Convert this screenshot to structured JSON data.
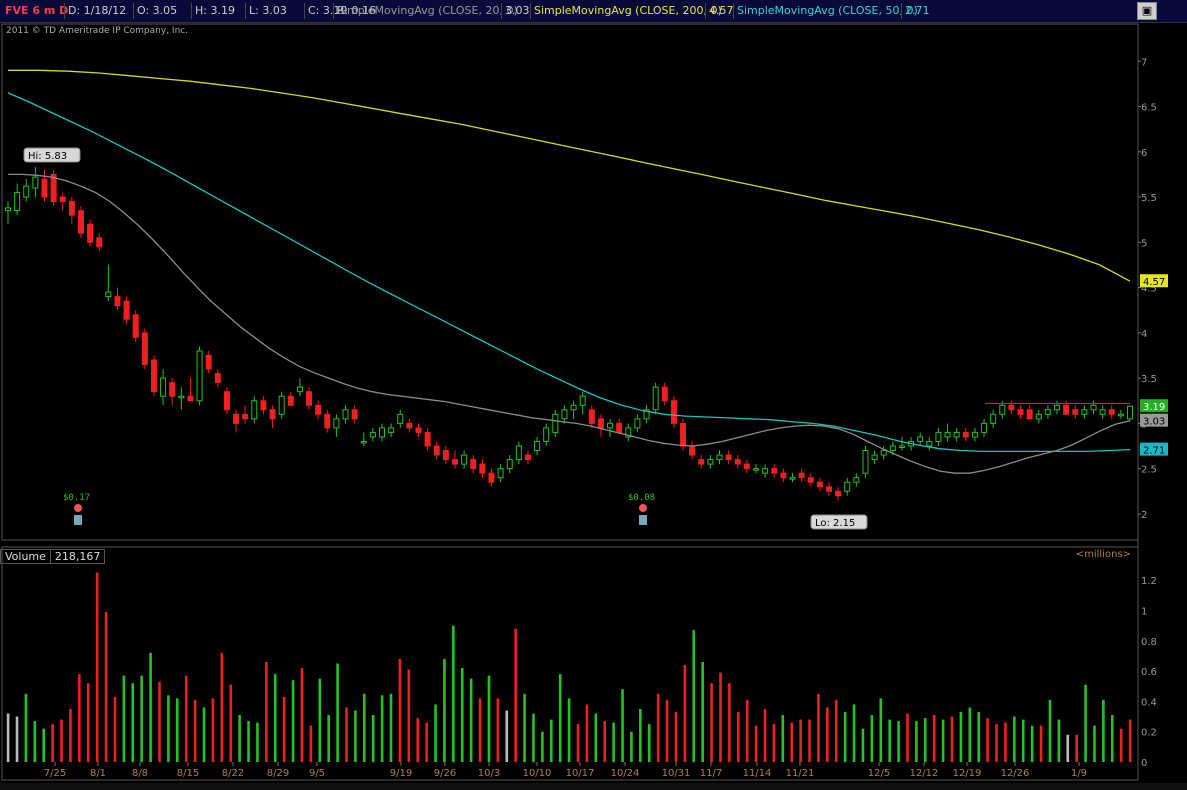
{
  "header": {
    "symbol": "FVE 6 m D",
    "date": "D: 1/18/12",
    "open": "O: 3.05",
    "high": "H: 3.19",
    "low": "L: 3.03",
    "close": "C: 3.19",
    "range": "R: 0.16",
    "sma20_label": "SimpleMovingAvg (CLOSE, 20, 0)",
    "sma20_value": "3.03",
    "sma200_label": "SimpleMovingAvg (CLOSE, 200, 0)",
    "sma200_value": "4.57",
    "sma50_label": "SimpleMovingAvg (CLOSE, 50, 0)",
    "sma50_value": "2.71"
  },
  "copyright": "2011 © TD Ameritrade IP Company, Inc.",
  "volume_panel": {
    "label": "Volume",
    "value": "218,167",
    "units": "<millions>"
  },
  "colors": {
    "up": "#22c322",
    "down": "#ee2020",
    "sma20": "#8c8c8c",
    "sma50": "#19c3c3",
    "sma200": "#d8d820",
    "bg": "#000000"
  },
  "chart_data": [
    {
      "type": "candlestick",
      "title": "FVE 6 m D",
      "ylim": [
        1.8,
        7.5
      ],
      "y_ticks": [
        2,
        2.5,
        3,
        3.5,
        4,
        4.5,
        5,
        5.5,
        6,
        6.5,
        7
      ],
      "x_ticks": [
        "7/25",
        "8/1",
        "8/8",
        "8/15",
        "8/22",
        "8/29",
        "9/5",
        "9/19",
        "9/26",
        "10/3",
        "10/10",
        "10/17",
        "10/24",
        "10/31",
        "11/7",
        "11/14",
        "11/21",
        "12/5",
        "12/12",
        "12/19",
        "12/26",
        "1/9"
      ],
      "annotations": {
        "high": "Hi: 5.83",
        "low": "Lo: 2.15",
        "dividends": [
          "$0.17",
          "$0.08"
        ]
      },
      "price_labels": {
        "close": "3.19",
        "sma20": "3.03",
        "sma50": "2.71",
        "sma200": "4.57"
      },
      "candles": [
        [
          5.35,
          5.45,
          5.2,
          5.38
        ],
        [
          5.35,
          5.65,
          5.3,
          5.55
        ],
        [
          5.5,
          5.7,
          5.45,
          5.62
        ],
        [
          5.6,
          5.83,
          5.5,
          5.72
        ],
        [
          5.7,
          5.8,
          5.45,
          5.5
        ],
        [
          5.75,
          5.8,
          5.4,
          5.45
        ],
        [
          5.5,
          5.55,
          5.35,
          5.45
        ],
        [
          5.45,
          5.5,
          5.2,
          5.3
        ],
        [
          5.35,
          5.4,
          5.05,
          5.1
        ],
        [
          5.2,
          5.25,
          4.95,
          5.0
        ],
        [
          5.05,
          5.1,
          4.9,
          4.95
        ],
        [
          4.4,
          4.75,
          4.35,
          4.45
        ],
        [
          4.4,
          4.5,
          4.25,
          4.3
        ],
        [
          4.35,
          4.4,
          4.1,
          4.15
        ],
        [
          4.2,
          4.25,
          3.9,
          3.95
        ],
        [
          4.0,
          4.05,
          3.6,
          3.65
        ],
        [
          3.7,
          3.75,
          3.3,
          3.35
        ],
        [
          3.3,
          3.6,
          3.2,
          3.5
        ],
        [
          3.45,
          3.5,
          3.2,
          3.3
        ],
        [
          3.3,
          3.4,
          3.15,
          3.3
        ],
        [
          3.3,
          3.5,
          3.25,
          3.25
        ],
        [
          3.25,
          3.85,
          3.2,
          3.8
        ],
        [
          3.75,
          3.8,
          3.55,
          3.6
        ],
        [
          3.55,
          3.6,
          3.4,
          3.45
        ],
        [
          3.35,
          3.4,
          3.1,
          3.15
        ],
        [
          3.1,
          3.15,
          2.9,
          3.0
        ],
        [
          3.1,
          3.2,
          3.0,
          3.05
        ],
        [
          3.05,
          3.3,
          3.0,
          3.25
        ],
        [
          3.25,
          3.3,
          3.1,
          3.15
        ],
        [
          3.15,
          3.2,
          2.95,
          3.05
        ],
        [
          3.1,
          3.35,
          3.05,
          3.3
        ],
        [
          3.3,
          3.35,
          3.2,
          3.2
        ],
        [
          3.35,
          3.5,
          3.3,
          3.4
        ],
        [
          3.35,
          3.4,
          3.15,
          3.2
        ],
        [
          3.2,
          3.25,
          3.05,
          3.1
        ],
        [
          3.1,
          3.15,
          2.9,
          2.95
        ],
        [
          2.95,
          3.1,
          2.85,
          3.05
        ],
        [
          3.05,
          3.2,
          3.0,
          3.15
        ],
        [
          3.15,
          3.2,
          3.0,
          3.05
        ],
        [
          2.8,
          2.9,
          2.75,
          2.8
        ],
        [
          2.85,
          2.95,
          2.8,
          2.9
        ],
        [
          2.85,
          3.0,
          2.8,
          2.95
        ],
        [
          2.9,
          3.0,
          2.85,
          2.95
        ],
        [
          3.0,
          3.15,
          2.95,
          3.1
        ],
        [
          3.0,
          3.05,
          2.9,
          2.95
        ],
        [
          2.95,
          3.0,
          2.85,
          2.9
        ],
        [
          2.9,
          2.95,
          2.7,
          2.75
        ],
        [
          2.75,
          2.8,
          2.6,
          2.65
        ],
        [
          2.7,
          2.75,
          2.55,
          2.6
        ],
        [
          2.6,
          2.7,
          2.5,
          2.55
        ],
        [
          2.55,
          2.7,
          2.5,
          2.65
        ],
        [
          2.6,
          2.65,
          2.45,
          2.5
        ],
        [
          2.55,
          2.6,
          2.4,
          2.45
        ],
        [
          2.45,
          2.5,
          2.3,
          2.35
        ],
        [
          2.4,
          2.55,
          2.35,
          2.5
        ],
        [
          2.5,
          2.65,
          2.45,
          2.6
        ],
        [
          2.6,
          2.8,
          2.55,
          2.75
        ],
        [
          2.65,
          2.7,
          2.55,
          2.6
        ],
        [
          2.7,
          2.85,
          2.65,
          2.8
        ],
        [
          2.8,
          3.0,
          2.75,
          2.95
        ],
        [
          2.9,
          3.15,
          2.85,
          3.1
        ],
        [
          3.05,
          3.2,
          3.0,
          3.15
        ],
        [
          3.15,
          3.25,
          3.05,
          3.2
        ],
        [
          3.2,
          3.35,
          3.1,
          3.3
        ],
        [
          3.15,
          3.2,
          2.95,
          3.0
        ],
        [
          3.05,
          3.1,
          2.85,
          2.95
        ],
        [
          2.95,
          3.05,
          2.85,
          3.0
        ],
        [
          3.0,
          3.05,
          2.9,
          2.9
        ],
        [
          2.85,
          3.0,
          2.8,
          2.95
        ],
        [
          2.95,
          3.1,
          2.9,
          3.05
        ],
        [
          3.05,
          3.2,
          3.0,
          3.15
        ],
        [
          3.15,
          3.45,
          3.1,
          3.4
        ],
        [
          3.4,
          3.45,
          3.2,
          3.25
        ],
        [
          3.25,
          3.3,
          2.95,
          3.0
        ],
        [
          3.0,
          3.05,
          2.7,
          2.75
        ],
        [
          2.75,
          2.8,
          2.6,
          2.65
        ],
        [
          2.6,
          2.65,
          2.5,
          2.55
        ],
        [
          2.55,
          2.65,
          2.5,
          2.6
        ],
        [
          2.6,
          2.7,
          2.55,
          2.65
        ],
        [
          2.65,
          2.7,
          2.55,
          2.6
        ],
        [
          2.6,
          2.65,
          2.5,
          2.55
        ],
        [
          2.55,
          2.6,
          2.45,
          2.5
        ],
        [
          2.5,
          2.55,
          2.45,
          2.5
        ],
        [
          2.45,
          2.55,
          2.4,
          2.5
        ],
        [
          2.5,
          2.55,
          2.4,
          2.45
        ],
        [
          2.45,
          2.5,
          2.35,
          2.4
        ],
        [
          2.4,
          2.45,
          2.35,
          2.4
        ],
        [
          2.45,
          2.5,
          2.35,
          2.4
        ],
        [
          2.4,
          2.45,
          2.3,
          2.35
        ],
        [
          2.35,
          2.4,
          2.25,
          2.3
        ],
        [
          2.3,
          2.35,
          2.2,
          2.25
        ],
        [
          2.25,
          2.3,
          2.15,
          2.2
        ],
        [
          2.25,
          2.4,
          2.2,
          2.35
        ],
        [
          2.35,
          2.45,
          2.3,
          2.4
        ],
        [
          2.45,
          2.75,
          2.4,
          2.7
        ],
        [
          2.6,
          2.7,
          2.55,
          2.65
        ],
        [
          2.65,
          2.75,
          2.6,
          2.7
        ],
        [
          2.7,
          2.8,
          2.65,
          2.75
        ],
        [
          2.75,
          2.85,
          2.7,
          2.75
        ],
        [
          2.75,
          2.85,
          2.7,
          2.8
        ],
        [
          2.8,
          2.9,
          2.75,
          2.85
        ],
        [
          2.75,
          2.85,
          2.7,
          2.8
        ],
        [
          2.8,
          2.95,
          2.75,
          2.9
        ],
        [
          2.85,
          3.0,
          2.8,
          2.9
        ],
        [
          2.85,
          2.95,
          2.8,
          2.9
        ],
        [
          2.9,
          2.95,
          2.8,
          2.85
        ],
        [
          2.85,
          2.95,
          2.8,
          2.9
        ],
        [
          2.9,
          3.05,
          2.85,
          3.0
        ],
        [
          3.0,
          3.15,
          2.95,
          3.1
        ],
        [
          3.1,
          3.25,
          3.05,
          3.2
        ],
        [
          3.2,
          3.25,
          3.1,
          3.15
        ],
        [
          3.15,
          3.2,
          3.05,
          3.1
        ],
        [
          3.15,
          3.2,
          3.05,
          3.05
        ],
        [
          3.05,
          3.15,
          3.0,
          3.1
        ],
        [
          3.1,
          3.2,
          3.05,
          3.15
        ],
        [
          3.15,
          3.25,
          3.1,
          3.2
        ],
        [
          3.2,
          3.25,
          3.1,
          3.1
        ],
        [
          3.15,
          3.2,
          3.05,
          3.1
        ],
        [
          3.1,
          3.2,
          3.05,
          3.15
        ],
        [
          3.15,
          3.25,
          3.1,
          3.2
        ],
        [
          3.1,
          3.2,
          3.05,
          3.15
        ],
        [
          3.15,
          3.2,
          3.05,
          3.1
        ],
        [
          3.1,
          3.15,
          3.05,
          3.1
        ],
        [
          3.05,
          3.19,
          3.03,
          3.19
        ]
      ],
      "sma20": [
        5.75,
        5.75,
        5.74,
        5.72,
        5.68,
        5.62,
        5.55,
        5.45,
        5.32,
        5.18,
        5.02,
        4.85,
        4.67,
        4.5,
        4.34,
        4.2,
        4.06,
        3.94,
        3.82,
        3.72,
        3.63,
        3.56,
        3.5,
        3.44,
        3.39,
        3.35,
        3.32,
        3.3,
        3.28,
        3.26,
        3.24,
        3.21,
        3.18,
        3.15,
        3.12,
        3.09,
        3.06,
        3.04,
        3.02,
        3.0,
        2.97,
        2.93,
        2.89,
        2.85,
        2.81,
        2.78,
        2.76,
        2.75,
        2.77,
        2.8,
        2.84,
        2.88,
        2.92,
        2.95,
        2.97,
        2.98,
        2.97,
        2.94,
        2.88,
        2.8,
        2.72,
        2.65,
        2.58,
        2.52,
        2.47,
        2.45,
        2.45,
        2.48,
        2.52,
        2.57,
        2.62,
        2.66,
        2.7,
        2.76,
        2.84,
        2.92,
        2.99,
        3.03
      ],
      "sma50": [
        6.65,
        6.55,
        6.44,
        6.33,
        6.22,
        6.1,
        5.98,
        5.86,
        5.73,
        5.6,
        5.47,
        5.34,
        5.21,
        5.08,
        4.95,
        4.82,
        4.69,
        4.56,
        4.44,
        4.32,
        4.2,
        4.08,
        3.96,
        3.84,
        3.72,
        3.6,
        3.49,
        3.38,
        3.28,
        3.2,
        3.14,
        3.1,
        3.08,
        3.07,
        3.06,
        3.05,
        3.04,
        3.02,
        3.0,
        2.97,
        2.92,
        2.87,
        2.81,
        2.76,
        2.72,
        2.7,
        2.69,
        2.69,
        2.69,
        2.69,
        2.69,
        2.69,
        2.7,
        2.71
      ],
      "sma200": [
        6.9,
        6.9,
        6.89,
        6.87,
        6.84,
        6.81,
        6.78,
        6.74,
        6.7,
        6.65,
        6.6,
        6.54,
        6.48,
        6.42,
        6.36,
        6.3,
        6.23,
        6.16,
        6.09,
        6.02,
        5.95,
        5.88,
        5.81,
        5.74,
        5.67,
        5.6,
        5.53,
        5.46,
        5.4,
        5.34,
        5.28,
        5.21,
        5.14,
        5.06,
        4.97,
        4.87,
        4.75,
        4.57
      ],
      "resistance": 3.22
    },
    {
      "type": "bar",
      "title": "Volume",
      "ylim": [
        0,
        1.3
      ],
      "y_ticks": [
        0,
        0.2,
        0.4,
        0.6,
        0.8,
        1,
        1.2
      ],
      "values": [
        0.32,
        0.3,
        0.45,
        0.27,
        0.22,
        0.25,
        0.28,
        0.35,
        0.58,
        0.52,
        1.25,
        0.99,
        0.43,
        0.57,
        0.52,
        0.57,
        0.72,
        0.53,
        0.44,
        0.42,
        0.57,
        0.41,
        0.36,
        0.42,
        0.72,
        0.51,
        0.31,
        0.27,
        0.26,
        0.66,
        0.58,
        0.43,
        0.54,
        0.62,
        0.24,
        0.55,
        0.31,
        0.65,
        0.36,
        0.34,
        0.45,
        0.31,
        0.44,
        0.45,
        0.68,
        0.61,
        0.29,
        0.26,
        0.38,
        0.68,
        0.9,
        0.62,
        0.55,
        0.42,
        0.57,
        0.42,
        0.34,
        0.88,
        0.45,
        0.32,
        0.2,
        0.28,
        0.58,
        0.42,
        0.25,
        0.38,
        0.32,
        0.27,
        0.26,
        0.48,
        0.2,
        0.35,
        0.25,
        0.45,
        0.41,
        0.33,
        0.64,
        0.87,
        0.66,
        0.52,
        0.59,
        0.52,
        0.33,
        0.41,
        0.24,
        0.35,
        0.25,
        0.31,
        0.26,
        0.28,
        0.28,
        0.45,
        0.36,
        0.41,
        0.33,
        0.38,
        0.22,
        0.31,
        0.42,
        0.28,
        0.27,
        0.32,
        0.27,
        0.29,
        0.31,
        0.28,
        0.3,
        0.33,
        0.36,
        0.33,
        0.29,
        0.25,
        0.26,
        0.3,
        0.28,
        0.24,
        0.24,
        0.41,
        0.28,
        0.18,
        0.18,
        0.51,
        0.24,
        0.41,
        0.31,
        0.22,
        0.28
      ],
      "up": [
        false,
        false,
        true,
        true,
        true,
        false,
        false,
        false,
        false,
        false,
        false,
        false,
        false,
        true,
        true,
        true,
        true,
        false,
        true,
        true,
        false,
        false,
        true,
        false,
        false,
        false,
        true,
        true,
        true,
        false,
        true,
        false,
        true,
        false,
        false,
        true,
        true,
        true,
        false,
        true,
        true,
        true,
        true,
        true,
        false,
        false,
        false,
        false,
        true,
        true,
        true,
        true,
        true,
        false,
        true,
        false,
        false,
        false,
        true,
        true,
        true,
        true,
        true,
        true,
        false,
        false,
        true,
        false,
        true,
        true,
        true,
        true,
        true,
        false,
        false,
        false,
        false,
        true,
        true,
        false,
        false,
        false,
        false,
        false,
        false,
        false,
        false,
        true,
        false,
        false,
        false,
        false,
        false,
        false,
        true,
        true,
        true,
        true,
        true,
        true,
        true,
        false,
        true,
        true,
        false,
        true,
        false,
        true,
        true,
        true,
        false,
        false,
        false,
        true,
        true,
        true,
        false,
        true,
        true,
        true,
        false,
        true,
        true,
        true,
        true
      ],
      "flat": [
        0,
        1,
        56,
        119
      ]
    }
  ]
}
